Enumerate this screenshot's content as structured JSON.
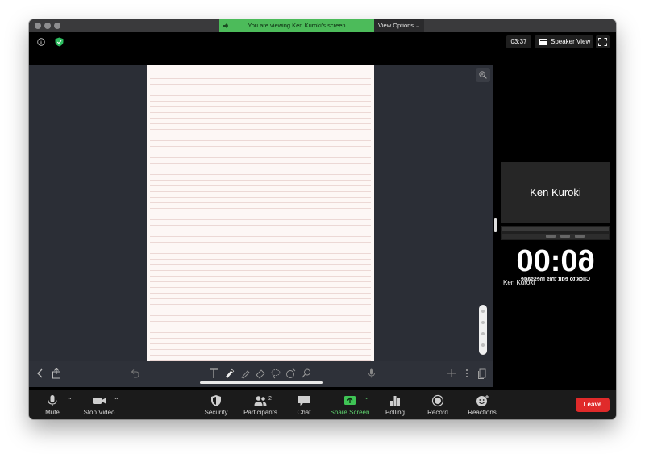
{
  "banner": {
    "viewing_text": "You are viewing Ken Kuroki's screen",
    "view_options_label": "View Options"
  },
  "meeting": {
    "timer": "03:37",
    "view_mode_label": "Speaker View"
  },
  "participant": {
    "name": "Ken Kuroki",
    "shared_timer_text": "60:00",
    "shared_hint_text": "Click to edit this message",
    "name_label": "Ken Kuroki"
  },
  "toolbar": {
    "mute": "Mute",
    "stop_video": "Stop Video",
    "security": "Security",
    "participants": "Participants",
    "participants_count": "2",
    "chat": "Chat",
    "share_screen": "Share Screen",
    "polling": "Polling",
    "record": "Record",
    "reactions": "Reactions",
    "leave": "Leave"
  },
  "colors": {
    "share_green": "#4cbb5a",
    "leave_red": "#e02a2a",
    "toolbar_bg": "#1b1b1b"
  }
}
